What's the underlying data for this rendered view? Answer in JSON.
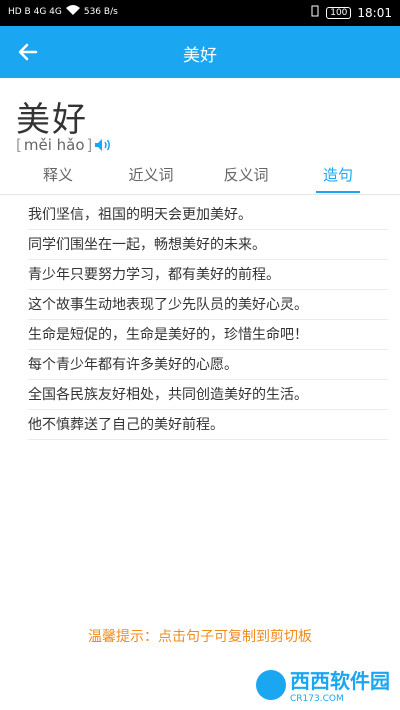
{
  "status": {
    "left_text": "HD B 4G 4G",
    "net_speed": "536 B/s",
    "battery": "100",
    "time": "18:01"
  },
  "header": {
    "title": "美好"
  },
  "word": {
    "text": "美好",
    "pinyin_open": "[",
    "pinyin": "měi hǎo",
    "pinyin_close": "]"
  },
  "tabs": [
    {
      "label": "释义"
    },
    {
      "label": "近义词"
    },
    {
      "label": "反义词"
    },
    {
      "label": "造句"
    }
  ],
  "active_tab": "造句",
  "sentences": [
    "我们坚信，祖国的明天会更加美好。",
    "同学们围坐在一起，畅想美好的未来。",
    "青少年只要努力学习，都有美好的前程。",
    "这个故事生动地表现了少先队员的美好心灵。",
    "生命是短促的，生命是美好的，珍惜生命吧！",
    "每个青少年都有许多美好的心愿。",
    "全国各民族友好相处，共同创造美好的生活。",
    "他不慎葬送了自己的美好前程。"
  ],
  "tip": "温馨提示：点击句子可复制到剪切板",
  "watermark": {
    "text": "西西软件园",
    "sub": "CR173.COM"
  },
  "colors": {
    "accent": "#1aa6f0",
    "tip": "#f08c1c"
  },
  "icons": {
    "back": "arrow-left-icon",
    "speaker": "speaker-icon"
  }
}
